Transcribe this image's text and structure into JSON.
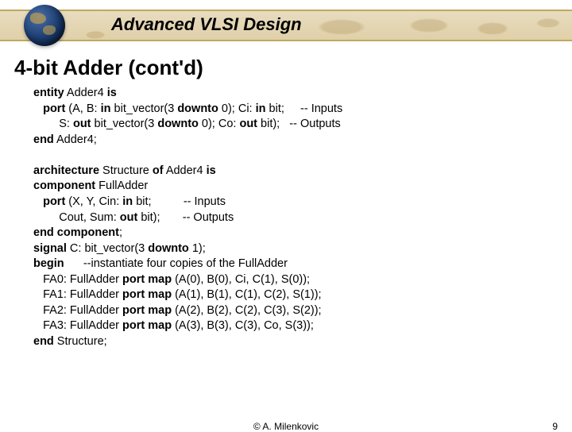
{
  "header": {
    "course_title": "Advanced VLSI Design"
  },
  "slide": {
    "title": "4-bit Adder (cont'd)"
  },
  "code": {
    "entity_line": "entity",
    "entity_name": " Adder4 ",
    "is_kw": "is",
    "port_kw": "port",
    "port_ab_open": " (A, B: ",
    "in_kw": "in",
    "bv30": " bit_vector(3 ",
    "downto_kw": "downto",
    "zero_ci": " 0); Ci: ",
    "bit_semi": " bit;",
    "inputs_comment": "     -- Inputs",
    "s_open": "        S: ",
    "out_kw": "out",
    "zero_co": " 0); Co: ",
    "bit_close": " bit);",
    "outputs_comment": "   -- Outputs",
    "end_kw": "end",
    "adder4_semi": " Adder4;",
    "blank": "",
    "arch_kw": "architecture",
    "structure": " Structure ",
    "of_kw": "of",
    "adder4_is": " Adder4 ",
    "component_kw": "component",
    "fulladder": " FullAdder",
    "xycin_open": " (X, Y, Cin: ",
    "bit_semi2": " bit;",
    "inputs_comment2": "          -- Inputs",
    "coutsum_open": "        Cout, Sum: ",
    "bit_close2": " bit);",
    "outputs_comment2": "       -- Outputs",
    "endcomp_kw": "end component",
    "semi": ";",
    "signal_kw": "signal",
    "c_decl_open": " C: bit_vector(3 ",
    "one_close": " 1);",
    "begin_kw": "begin",
    "inst_comment": "      --instantiate four copies of the FullAdder",
    "fa0a": "   FA0: FullAdder ",
    "portmap_kw": "port map",
    "fa0b": " (A(0), B(0), Ci, C(1), S(0));",
    "fa1a": "   FA1: FullAdder ",
    "fa1b": " (A(1), B(1), C(1), C(2), S(1));",
    "fa2a": "   FA2: FullAdder ",
    "fa2b": " (A(2), B(2), C(2), C(3), S(2));",
    "fa3a": "   FA3: FullAdder ",
    "fa3b": " (A(3), B(3), C(3), Co, S(3));",
    "structure_semi": " Structure;"
  },
  "footer": {
    "copyright": "© A. Milenkovic",
    "page": "9"
  }
}
